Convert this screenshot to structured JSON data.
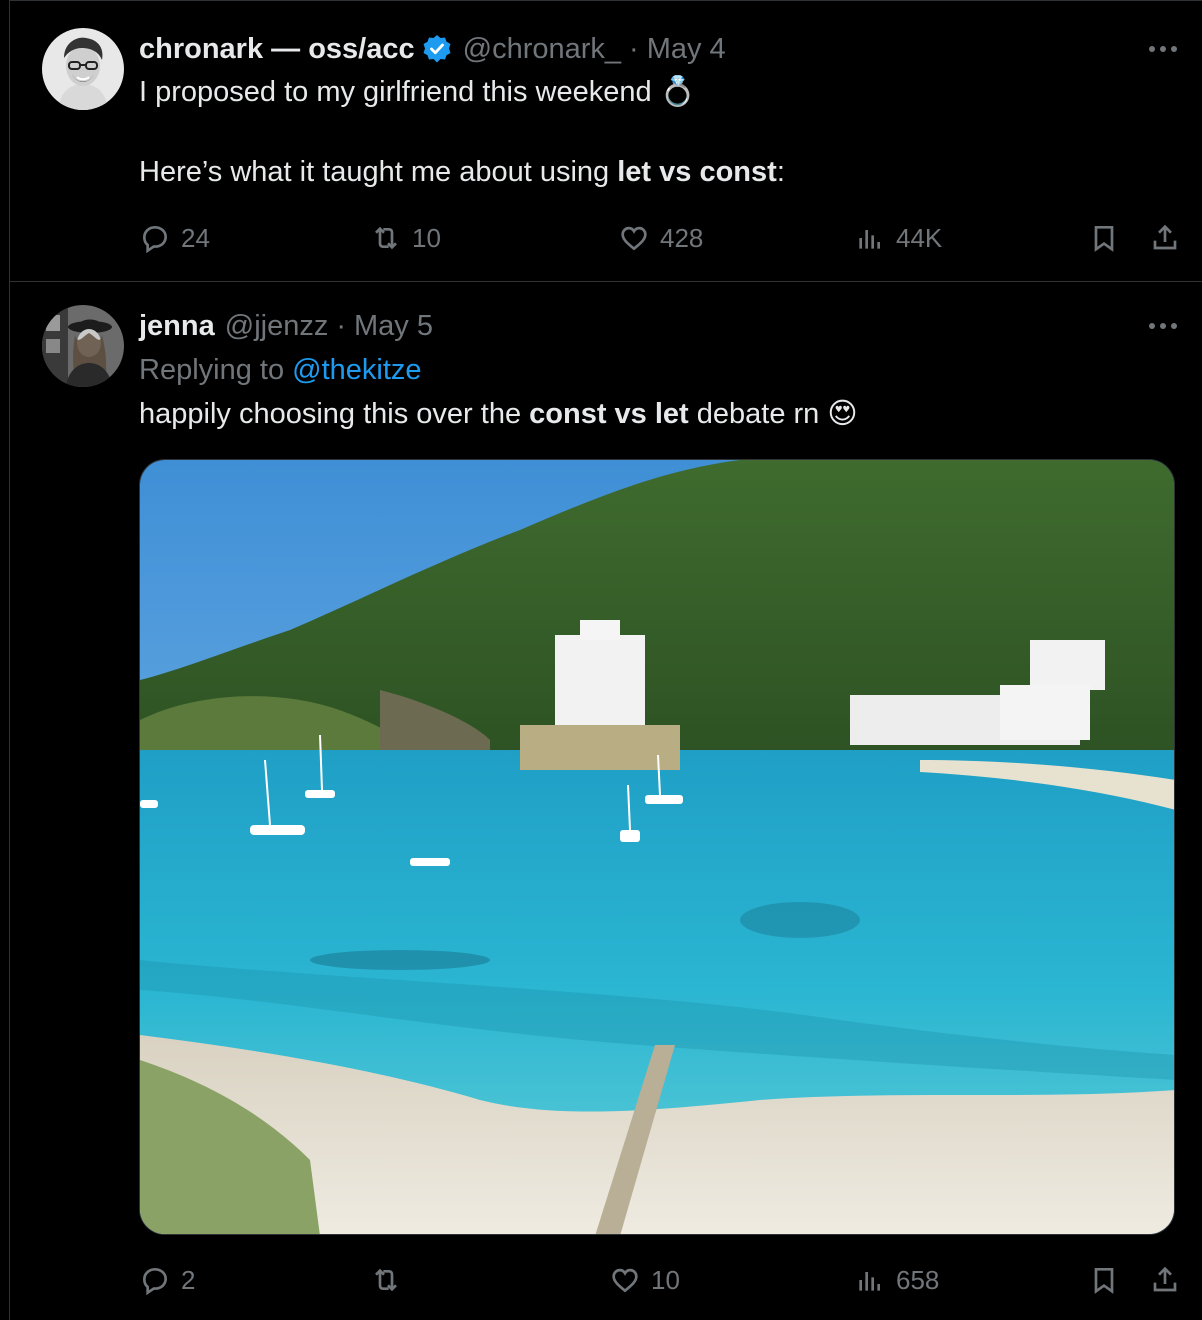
{
  "colors": {
    "background": "#000000",
    "text": "#e7e9ea",
    "muted": "#71767b",
    "link": "#1d9bf0",
    "verified": "#1d9bf0"
  },
  "tweets": [
    {
      "author_name": "chronark — oss/acc",
      "verified": true,
      "handle": "@chronark_",
      "separator": "·",
      "date": "May 4",
      "text_line1": "I proposed to my girlfriend this weekend ",
      "emoji": "💍",
      "text_line2_prefix": "Here’s what it taught me about using ",
      "text_line2_bold": "let vs const",
      "text_line2_suffix": ":",
      "replies": "24",
      "retweets": "10",
      "likes": "428",
      "views": "44K"
    },
    {
      "author_name": "jenna",
      "handle": "@jjenzz",
      "separator": "·",
      "date": "May 5",
      "replying_prefix": "Replying to ",
      "replying_to": "@thekitze",
      "text_prefix": "happily choosing this over the ",
      "text_bold": "const vs let",
      "text_suffix": " debate rn ",
      "emoji": "😍",
      "image_icon": "photo-bay-beach",
      "replies": "2",
      "retweets": "",
      "likes": "10",
      "views": "658"
    }
  ],
  "icons": {
    "reply": "reply-icon",
    "retweet": "retweet-icon",
    "like": "like-icon",
    "views": "views-icon",
    "bookmark": "bookmark-icon",
    "share": "share-icon",
    "more": "more-icon"
  }
}
